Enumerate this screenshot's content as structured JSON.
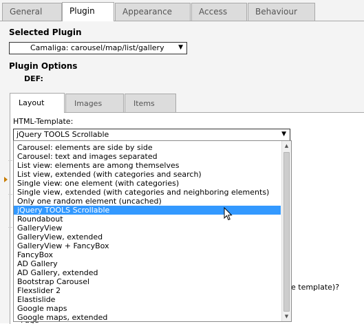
{
  "tabs": [
    {
      "label": "General"
    },
    {
      "label": "Plugin"
    },
    {
      "label": "Appearance"
    },
    {
      "label": "Access"
    },
    {
      "label": "Behaviour"
    }
  ],
  "selected_plugin": {
    "heading": "Selected Plugin",
    "value": "Camaliga: carousel/map/list/gallery"
  },
  "plugin_options": {
    "heading": "Plugin Options",
    "sheet": "DEF:"
  },
  "inner_tabs": [
    {
      "label": "Layout"
    },
    {
      "label": "Images"
    },
    {
      "label": "Items"
    }
  ],
  "template": {
    "label": "HTML-Template:",
    "value": "jQuery TOOLS Scrollable",
    "options": [
      "Carousel: elements are side by side",
      "Carousel: text and images separated",
      "List view: elements are among themselves",
      "List view, extended (with categories and search)",
      "Single view: one element (with categories)",
      "Single view, extended (with categories and neighboring elements)",
      "Only one random element (uncached)",
      "jQuery TOOLS Scrollable",
      "Roundabout",
      "GalleryView",
      "GalleryView, extended",
      "GalleryView + FancyBox",
      "FancyBox",
      "AD Gallery",
      "AD Gallery, extended",
      "Bootstrap Carousel",
      "Flexslider 2",
      "Elastislide",
      "Google maps",
      "Google maps, extended"
    ],
    "selected_index": 7
  },
  "background_text": {
    "partial_question": "e template)?",
    "partial_bottom": "Page"
  },
  "colors": {
    "selection": "#3399ff",
    "marker": "#c87c00"
  }
}
